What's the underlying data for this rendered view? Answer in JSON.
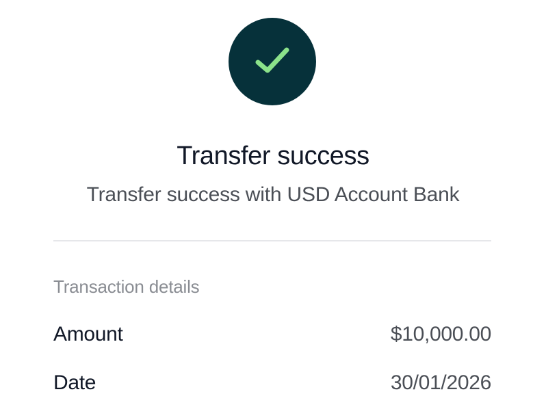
{
  "status": {
    "icon": "check-icon",
    "badge_color": "#06313a",
    "check_color": "#8be28a"
  },
  "header": {
    "title": "Transfer success",
    "subtitle": "Transfer success with USD Account Bank"
  },
  "details": {
    "section_label": "Transaction details",
    "rows": [
      {
        "label": "Amount",
        "value": "$10,000.00"
      },
      {
        "label": "Date",
        "value": "30/01/2026"
      }
    ]
  }
}
